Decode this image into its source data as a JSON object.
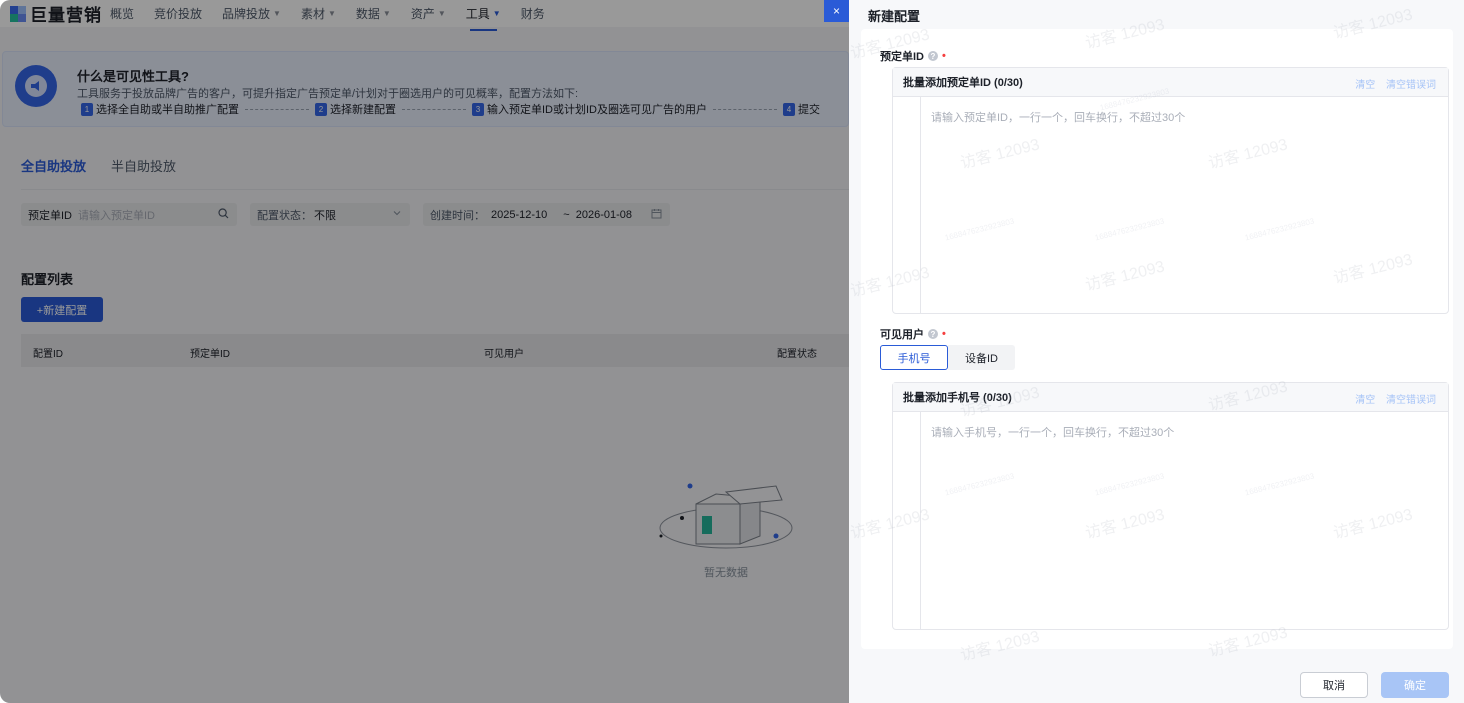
{
  "brand": {
    "name": "巨量营销"
  },
  "nav": {
    "items": [
      {
        "label": "概览",
        "caret": false,
        "active": false
      },
      {
        "label": "竞价投放",
        "caret": false,
        "active": false
      },
      {
        "label": "品牌投放",
        "caret": true,
        "active": false
      },
      {
        "label": "素材",
        "caret": true,
        "active": false
      },
      {
        "label": "数据",
        "caret": true,
        "active": false
      },
      {
        "label": "资产",
        "caret": true,
        "active": false
      },
      {
        "label": "工具",
        "caret": true,
        "active": true
      },
      {
        "label": "财务",
        "caret": false,
        "active": false
      }
    ]
  },
  "banner": {
    "title": "什么是可见性工具?",
    "desc": "工具服务于投放品牌广告的客户，可提升指定广告预定单/计划对于圈选用户的可见概率，配置方法如下:",
    "steps": [
      {
        "num": "1",
        "label": "选择全自助或半自助推广配置"
      },
      {
        "num": "2",
        "label": "选择新建配置"
      },
      {
        "num": "3",
        "label": "输入预定单ID或计划ID及圈选可见广告的用户"
      },
      {
        "num": "4",
        "label": "提交"
      }
    ]
  },
  "tabs": [
    {
      "label": "全自助投放",
      "active": true
    },
    {
      "label": "半自助投放",
      "active": false
    }
  ],
  "filters": {
    "order_id": {
      "label": "预定单ID",
      "placeholder": "请输入预定单ID"
    },
    "status": {
      "label": "配置状态：",
      "value": "不限"
    },
    "created": {
      "label": "创建时间：",
      "start": "2025-12-10",
      "sep": "~",
      "end": "2026-01-08"
    }
  },
  "list": {
    "title": "配置列表",
    "new_button": "+新建配置",
    "columns": [
      "配置ID",
      "预定单ID",
      "可见用户",
      "配置状态"
    ],
    "empty_text": "暂无数据"
  },
  "drawer": {
    "close_icon": "×",
    "title": "新建配置",
    "order_field": {
      "label": "预定单ID",
      "box_title": "批量添加预定单ID (0/30)",
      "clear": "清空",
      "clear_errors": "清空错误词",
      "placeholder": "请输入预定单ID，一行一个，回车换行，不超过30个"
    },
    "users_field": {
      "label": "可见用户",
      "options": [
        "手机号",
        "设备ID"
      ],
      "selected": "手机号",
      "box_title": "批量添加手机号 (0/30)",
      "clear": "清空",
      "clear_errors": "清空错误词",
      "placeholder": "请输入手机号，一行一个，回车换行，不超过30个"
    },
    "cancel": "取消",
    "confirm": "确定"
  },
  "watermark": {
    "text": "访客 12093",
    "id": "1688476232923803"
  },
  "colors": {
    "primary": "#2a5bd7",
    "required": "#f53f3f",
    "disabled_primary": "#a8c5f6"
  }
}
